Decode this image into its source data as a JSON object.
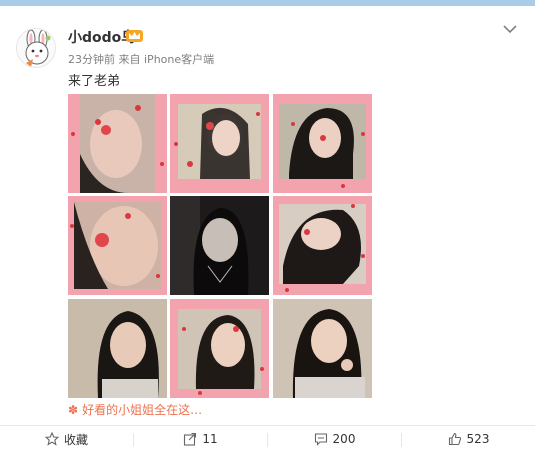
{
  "post": {
    "username": "小dodo鸟",
    "time": "23分钟前",
    "source_prefix": "来自",
    "source": "iPhone客户端",
    "text": "来了老弟",
    "photos_caption": "好看的小姐姐全在这…"
  },
  "actions": {
    "favorite_label": "收藏",
    "repost_count": "11",
    "comment_count": "200",
    "like_count": "523"
  },
  "colors": {
    "accent": "#eb7350",
    "top_bar": "#a9cde8",
    "photo_frame_pink": "#f2a3ad"
  },
  "icons": [
    "avatar-rabbit-icon",
    "vip-crown-icon",
    "chevron-down-icon",
    "star-icon",
    "share-icon",
    "comment-icon",
    "thumbs-up-icon",
    "flower-icon"
  ]
}
